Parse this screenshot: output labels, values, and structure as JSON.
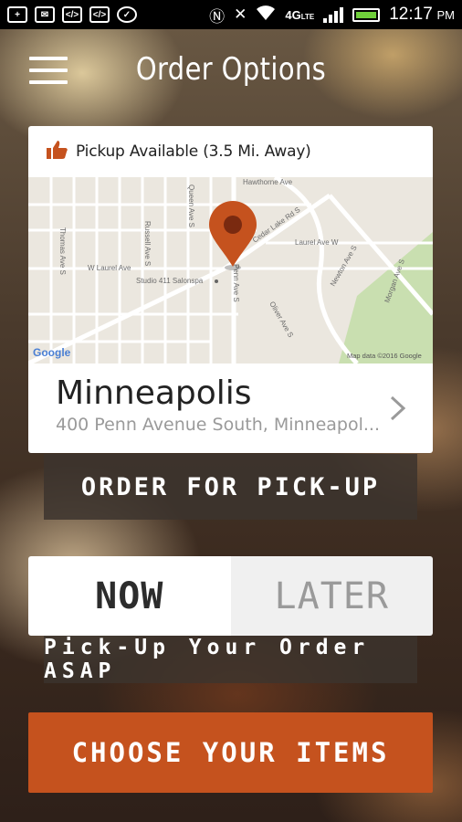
{
  "status_bar": {
    "time": "12:17",
    "ampm": "PM",
    "network": "4G",
    "network_sub": "LTE"
  },
  "header": {
    "title": "Order Options"
  },
  "location_card": {
    "availability": "Pickup Available (3.5 Mi. Away)",
    "city": "Minneapolis",
    "address": "400 Penn Avenue South, Minneapol...",
    "map": {
      "streets": [
        "Hawthorne Ave",
        "Cedar Lake Rd S",
        "Laurel Ave W",
        "W Laurel Ave",
        "Thomas Ave S",
        "Russell Ave S",
        "Queen Ave S",
        "Penn Ave S",
        "Oliver Ave S",
        "Newton Ave S",
        "Morgan Ave S"
      ],
      "poi": "Studio 411 Salonspa",
      "logo": "Google",
      "attribution": "Map data ©2016 Google"
    }
  },
  "buttons": {
    "pickup": "ORDER FOR PICK-UP",
    "now": "NOW",
    "later": "LATER",
    "asap": "Pick-Up Your Order ASAP",
    "choose": "CHOOSE YOUR ITEMS"
  },
  "colors": {
    "accent": "#c5521e",
    "pin": "#c5521e"
  },
  "icons": {
    "menu": "hamburger-menu-icon",
    "availability": "thumbs-up-icon",
    "map_pin": "map-pin-icon",
    "next": "chevron-right-icon"
  },
  "selected_time_option": "NOW"
}
